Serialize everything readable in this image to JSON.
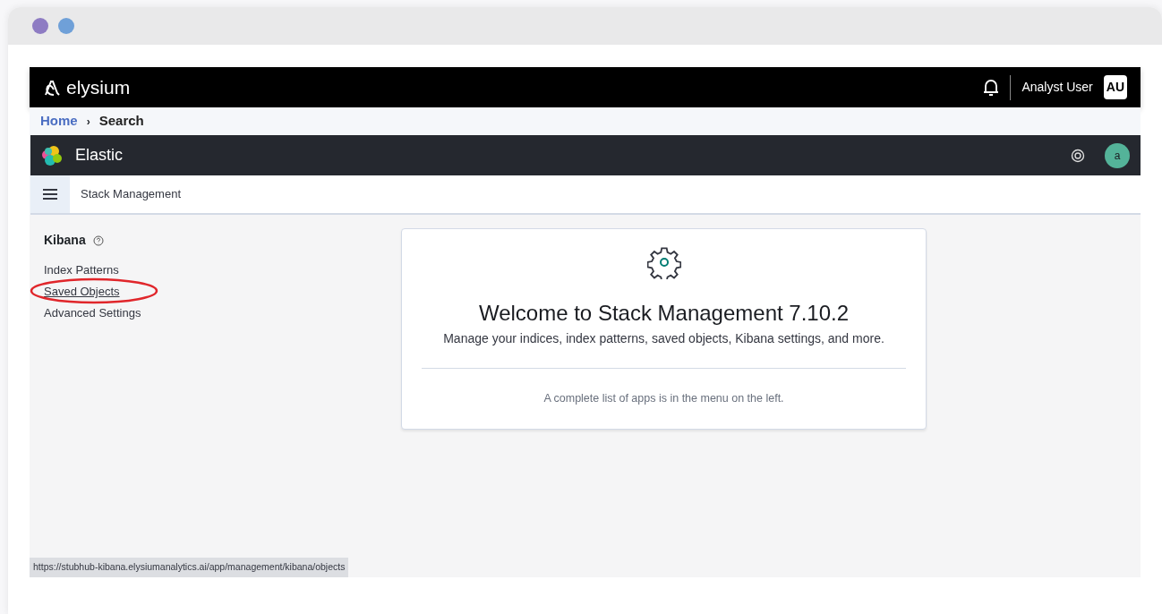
{
  "window": {
    "dots": [
      {
        "color": "#8e7cc3"
      },
      {
        "color": "#6fa0d8"
      }
    ]
  },
  "header": {
    "logo": "elysium",
    "user_name": "Analyst User",
    "user_initials": "AU"
  },
  "breadcrumb": [
    {
      "label": "Home",
      "kind": "link"
    },
    {
      "label": "›",
      "kind": "separator"
    },
    {
      "label": "Search",
      "kind": "current"
    }
  ],
  "app_bar": {
    "title": "Elastic",
    "avatar": "a"
  },
  "sub_bar": {
    "title": "Stack Management"
  },
  "sidebar": {
    "heading": "Kibana",
    "items": [
      {
        "label": "Index Patterns",
        "selected": false,
        "circled": false
      },
      {
        "label": "Saved Objects",
        "selected": true,
        "circled": true
      },
      {
        "label": "Advanced Settings",
        "selected": false,
        "circled": false
      }
    ]
  },
  "panel": {
    "title": "Welcome to Stack Management 7.10.2",
    "subtitle": "Manage your indices, index patterns, saved objects, Kibana settings, and more.",
    "footer": "A complete list of apps is in the menu on the left."
  },
  "status_bar": {
    "url": "https://stubhub-kibana.elysiumanalytics.ai/app/management/kibana/objects"
  }
}
